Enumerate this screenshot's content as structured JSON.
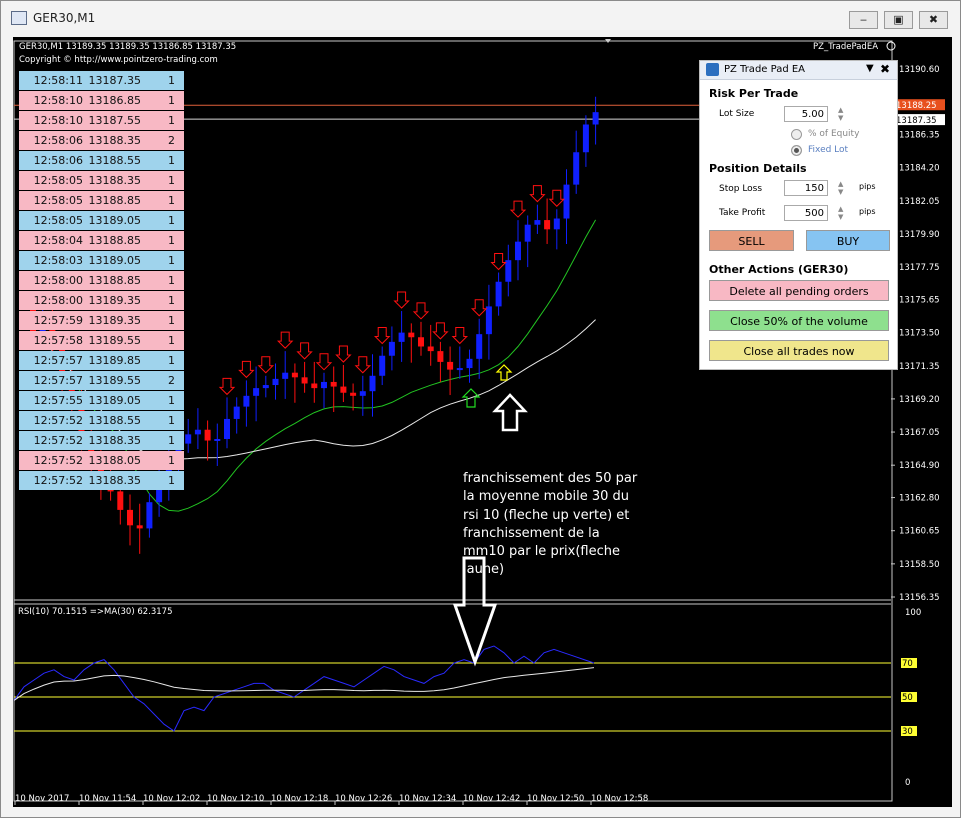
{
  "window": {
    "title": "GER30,M1",
    "minimize": "‒",
    "restore": "▣",
    "close": "✖"
  },
  "chart": {
    "info": "GER30,M1  13189.35  13189.35  13186.85  13187.35",
    "copyright": "Copyright © http://www.pointzero-trading.com",
    "ea_label": "PZ_TradePadEA",
    "price_ticks": [
      "13190.60",
      "13188.25",
      "13187.35",
      "13186.35",
      "13184.20",
      "13182.05",
      "13179.90",
      "13177.75",
      "13175.65",
      "13173.50",
      "13171.35",
      "13169.20",
      "13167.05",
      "13164.90",
      "13162.80",
      "13160.65",
      "13158.50",
      "13156.35"
    ],
    "bid_tag": "13188.25",
    "ask_tag": "13187.35",
    "rsi_label": "RSI(10) 70.1515  =>MA(30) 62.3175",
    "rsi_ticks": [
      "100",
      "70",
      "50",
      "30",
      "0"
    ],
    "time_ticks": [
      "10 Nov 2017",
      "10 Nov 11:54",
      "10 Nov 12:02",
      "10 Nov 12:10",
      "10 Nov 12:18",
      "10 Nov 12:26",
      "10 Nov 12:34",
      "10 Nov 12:42",
      "10 Nov 12:50",
      "10 Nov 12:58"
    ],
    "annotation": [
      "franchissement des 50 par",
      "la moyenne mobile 30 du",
      "rsi 10 (fleche up verte) et",
      "franchissement de la",
      "mm10 par le prix(fleche",
      "jaune)"
    ],
    "colors": {
      "bull": "#1020ff",
      "bear": "#ff1010",
      "ma_green": "#22c422",
      "ma_white": "#e8e8e8",
      "rsi": "#2a2aff",
      "level": "#ffff33",
      "bid_line": "#e0603a"
    }
  },
  "time_sales": [
    {
      "time": "12:58:11",
      "price": "13187.35",
      "vol": "1",
      "side": "buy"
    },
    {
      "time": "12:58:10",
      "price": "13186.85",
      "vol": "1",
      "side": "sell"
    },
    {
      "time": "12:58:10",
      "price": "13187.55",
      "vol": "1",
      "side": "sell"
    },
    {
      "time": "12:58:06",
      "price": "13188.35",
      "vol": "2",
      "side": "sell"
    },
    {
      "time": "12:58:06",
      "price": "13188.55",
      "vol": "1",
      "side": "buy"
    },
    {
      "time": "12:58:05",
      "price": "13188.35",
      "vol": "1",
      "side": "sell"
    },
    {
      "time": "12:58:05",
      "price": "13188.85",
      "vol": "1",
      "side": "sell"
    },
    {
      "time": "12:58:05",
      "price": "13189.05",
      "vol": "1",
      "side": "buy"
    },
    {
      "time": "12:58:04",
      "price": "13188.85",
      "vol": "1",
      "side": "sell"
    },
    {
      "time": "12:58:03",
      "price": "13189.05",
      "vol": "1",
      "side": "buy"
    },
    {
      "time": "12:58:00",
      "price": "13188.85",
      "vol": "1",
      "side": "sell"
    },
    {
      "time": "12:58:00",
      "price": "13189.35",
      "vol": "1",
      "side": "sell"
    },
    {
      "time": "12:57:59",
      "price": "13189.35",
      "vol": "1",
      "side": "sell"
    },
    {
      "time": "12:57:58",
      "price": "13189.55",
      "vol": "1",
      "side": "sell"
    },
    {
      "time": "12:57:57",
      "price": "13189.85",
      "vol": "1",
      "side": "buy"
    },
    {
      "time": "12:57:57",
      "price": "13189.55",
      "vol": "2",
      "side": "buy"
    },
    {
      "time": "12:57:55",
      "price": "13189.05",
      "vol": "1",
      "side": "buy"
    },
    {
      "time": "12:57:52",
      "price": "13188.55",
      "vol": "1",
      "side": "buy"
    },
    {
      "time": "12:57:52",
      "price": "13188.35",
      "vol": "1",
      "side": "buy"
    },
    {
      "time": "12:57:52",
      "price": "13188.05",
      "vol": "1",
      "side": "sell"
    },
    {
      "time": "12:57:52",
      "price": "13188.35",
      "vol": "1",
      "side": "buy"
    }
  ],
  "trade_pad": {
    "title": "PZ Trade Pad EA",
    "pin": "▼",
    "close": "✖",
    "risk_heading": "Risk Per Trade",
    "lot_label": "Lot Size",
    "lot_value": "5.00",
    "equity_option": "% of Equity",
    "fixed_option": "Fixed Lot",
    "position_heading": "Position Details",
    "sl_label": "Stop Loss",
    "sl_value": "150",
    "tp_label": "Take Profit",
    "tp_value": "500",
    "pips": "pips",
    "spin": "▲\n▼",
    "sell": "SELL",
    "buy": "BUY",
    "other_heading": "Other Actions (GER30)",
    "delete_pending": "Delete all pending orders",
    "close_half": "Close 50% of the volume",
    "close_all": "Close all trades now"
  }
}
